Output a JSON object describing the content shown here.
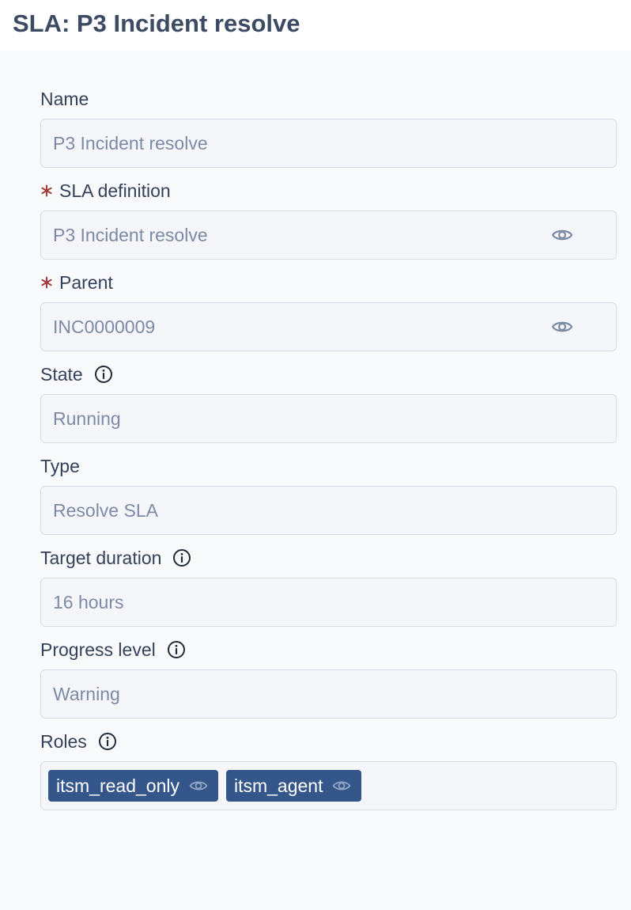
{
  "page": {
    "title": "SLA: P3 Incident resolve"
  },
  "fields": {
    "name": {
      "label": "Name",
      "value": "P3 Incident resolve"
    },
    "sla_definition": {
      "label": "SLA definition",
      "value": "P3 Incident resolve",
      "required": true
    },
    "parent": {
      "label": "Parent",
      "value": "INC0000009",
      "required": true
    },
    "state": {
      "label": "State",
      "value": "Running"
    },
    "type": {
      "label": "Type",
      "value": "Resolve SLA"
    },
    "target_duration": {
      "label": "Target duration",
      "value": "16 hours"
    },
    "progress_level": {
      "label": "Progress level",
      "value": "Warning"
    },
    "roles": {
      "label": "Roles",
      "items": [
        "itsm_read_only",
        "itsm_agent"
      ]
    }
  },
  "icons": {
    "required": "asterisk-icon",
    "info": "info-circle-icon",
    "view": "eye-icon"
  },
  "colors": {
    "title": "#3d4a63",
    "label": "#34415a",
    "value": "#7d8aa6",
    "required": "#a33b3b",
    "chip": "#34568a",
    "form_bg": "#f9fafb",
    "input_bg": "#f5f6f9",
    "input_border": "#d9dde5"
  }
}
